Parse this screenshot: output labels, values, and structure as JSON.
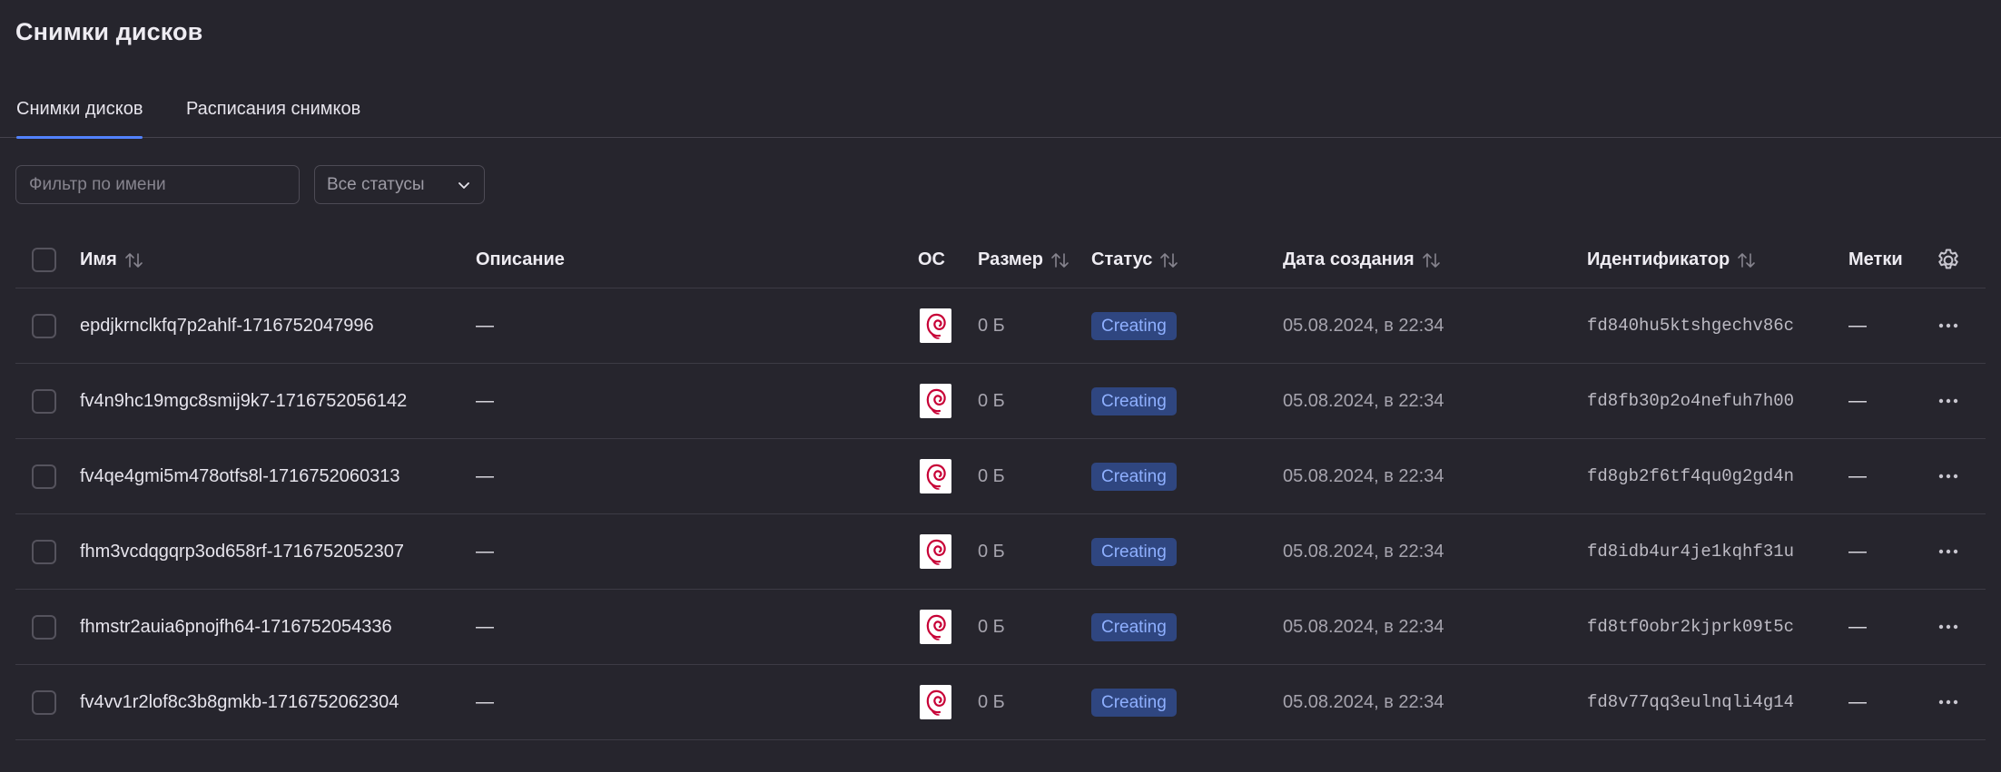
{
  "page": {
    "title": "Снимки дисков"
  },
  "tabs": [
    {
      "label": "Снимки дисков",
      "active": true
    },
    {
      "label": "Расписания снимков",
      "active": false
    }
  ],
  "filters": {
    "name_placeholder": "Фильтр по имени",
    "status_select": "Все статусы"
  },
  "table": {
    "columns": {
      "name": "Имя",
      "description": "Описание",
      "os": "ОС",
      "size": "Размер",
      "status": "Статус",
      "created": "Дата создания",
      "id": "Идентификатор",
      "labels": "Метки"
    },
    "rows": [
      {
        "name": "epdjkrnclkfq7p2ahlf-1716752047996",
        "description": "—",
        "os": "debian-logo",
        "size": "0 Б",
        "status": "Creating",
        "created": "05.08.2024, в 22:34",
        "id": "fd840hu5ktshgechv86c",
        "labels": "—"
      },
      {
        "name": "fv4n9hc19mgc8smij9k7-1716752056142",
        "description": "—",
        "os": "debian-logo",
        "size": "0 Б",
        "status": "Creating",
        "created": "05.08.2024, в 22:34",
        "id": "fd8fb30p2o4nefuh7h00",
        "labels": "—"
      },
      {
        "name": "fv4qe4gmi5m478otfs8l-1716752060313",
        "description": "—",
        "os": "debian-logo",
        "size": "0 Б",
        "status": "Creating",
        "created": "05.08.2024, в 22:34",
        "id": "fd8gb2f6tf4qu0g2gd4n",
        "labels": "—"
      },
      {
        "name": "fhm3vcdqgqrp3od658rf-1716752052307",
        "description": "—",
        "os": "debian-logo",
        "size": "0 Б",
        "status": "Creating",
        "created": "05.08.2024, в 22:34",
        "id": "fd8idb4ur4je1kqhf31u",
        "labels": "—"
      },
      {
        "name": "fhmstr2auia6pnojfh64-1716752054336",
        "description": "—",
        "os": "debian-logo",
        "size": "0 Б",
        "status": "Creating",
        "created": "05.08.2024, в 22:34",
        "id": "fd8tf0obr2kjprk09t5c",
        "labels": "—"
      },
      {
        "name": "fv4vv1r2lof8c3b8gmkb-1716752062304",
        "description": "—",
        "os": "debian-logo",
        "size": "0 Б",
        "status": "Creating",
        "created": "05.08.2024, в 22:34",
        "id": "fd8v77qq3eulnqli4g14",
        "labels": "—"
      }
    ]
  },
  "colors": {
    "background": "#26252d",
    "accent": "#5282ff",
    "status_badge_bg": "#2f4680",
    "status_badge_text": "#8fb0ff",
    "debian_red": "#c70036"
  }
}
